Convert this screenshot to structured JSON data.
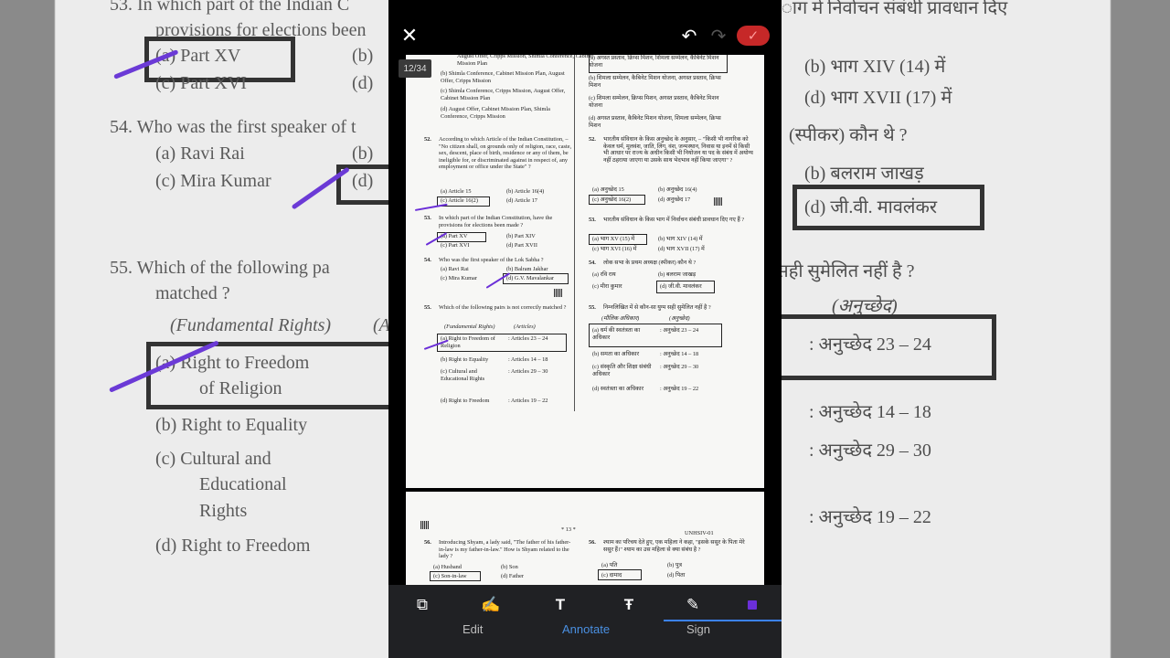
{
  "background": {
    "left": {
      "q53": "53.  In which part of the Indian C",
      "q53b": "provisions for elections been",
      "opt_a": "(a)  Part XV",
      "opt_b": "(b)",
      "opt_c": "(c)  Part XVI",
      "opt_d": "(d)",
      "q54": "54.  Who was the first speaker of t",
      "q54a": "(a)  Ravi Rai",
      "q54b": "(b)",
      "q54c": "(c)  Mira Kumar",
      "q54d": "(d)",
      "q55": "55.  Which of the following pa",
      "q55b": "matched ?",
      "fr": "(Fundamental Rights)",
      "fr2": "(A",
      "a1": "(a)  Right to Freedom",
      "a1b": "of Religion",
      "b1": "(b)  Right to Equality",
      "c1": "(c)  Cultural and",
      "c1b": "Educational",
      "c1c": "Rights",
      "d1": "(d)  Right to Freedom"
    },
    "right": {
      "top": "ाग में निर्वाचन संबंधी प्रावधान दिए",
      "b": "(b)  भाग XIV (14) में",
      "d": "(d)  भाग XVII (17) में",
      "spk": "(स्पीकर) कौन थे ?",
      "bb": "(b)  बलराम जाखड़",
      "dd": "(d)  जी.वी. मावलंकर",
      "q55": "युग्म सही सुमेलित नहीं है ?",
      "art": "(अनुच्छेद)",
      "r1": ":  अनुच्छेद 23 – 24",
      "r2": ":  अनुच्छेद 14 – 18",
      "r3": ":  अनुच्छेद 29 – 30",
      "r4": ":  अनुच्छेद 19 – 22"
    }
  },
  "viewer": {
    "page_indicator": "12/34",
    "close_icon": "✕",
    "undo_icon": "↶",
    "redo_icon": "↷",
    "confirm_icon": "✓"
  },
  "page1": {
    "left": {
      "q51_b": "(b)  Shimla Conference, Cabinet Mission Plan, August Offer, Cripps Mission",
      "q51_c": "(c)  Shimla Conference, Cripps Mission, August Offer, Cabinet Mission Plan",
      "q51_d": "(d)  August Offer, Cabinet Mission Plan, Shimla Conference, Cripps Mission",
      "q51_top": "August Offer, Cripps Mission, Shimla Conference, Cabinet Mission Plan",
      "q52_num": "52.",
      "q52_text": "According to which Article of the Indian Constitution, – \"No citizen shall, on grounds only of religion, race, caste, sex, descent, place of birth, residence or any of them, be ineligible for, or discriminated against in respect of, any employment or office under the State\" ?",
      "q52_a": "(a)  Article 15",
      "q52_b": "(b)  Article 16(4)",
      "q52_c": "(c)  Article 16(2)",
      "q52_d": "(d)  Article 17",
      "q53_num": "53.",
      "q53_text": "In which part of the Indian Constitution, have the provisions for elections been made ?",
      "q53_a": "(a)  Part XV",
      "q53_b": "(b)  Part XIV",
      "q53_c": "(c)  Part XVI",
      "q53_d": "(d)  Part XVII",
      "q54_num": "54.",
      "q54_text": "Who was the first speaker of the Lok Sabha ?",
      "q54_a": "(a)  Ravi Rai",
      "q54_b": "(b)  Balram Jakhar",
      "q54_c": "(c)  Mira Kumar",
      "q54_d": "(d)  G.V. Mavalankar",
      "q55_num": "55.",
      "q55_text": "Which of the following pairs is not correctly matched ?",
      "q55_h1": "(Fundamental Rights)",
      "q55_h2": "(Articles)",
      "q55_a": "(a)  Right to Freedom of Religion",
      "q55_a2": ":  Articles 23 – 24",
      "q55_b": "(b)  Right to Equality",
      "q55_b2": ":  Articles 14 – 18",
      "q55_c": "(c)  Cultural and Educational Rights",
      "q55_c2": ":  Articles 29 – 30",
      "q55_d": "(d)  Right to Freedom",
      "q55_d2": ":  Articles 19 – 22"
    },
    "right": {
      "q51_a": "(a)  अगस्त प्रस्ताव, क्रिप्स मिशन, शिमला सम्मेलन, कैबिनेट मिशन योजना",
      "q51_b": "(b)  शिमला सम्मेलन, कैबिनेट मिशन योजना, अगस्त प्रस्ताव, क्रिप्स मिशन",
      "q51_c": "(c)  शिमला सम्मेलन, क्रिप्स मिशन, अगस्त प्रस्ताव, कैबिनेट मिशन योजना",
      "q51_d": "(d)  अगस्त प्रस्ताव, कैबिनेट मिशन योजना, शिमला सम्मेलन, क्रिप्स मिशन",
      "q52_num": "52.",
      "q52_text": "भारतीय संविधान के किस अनुच्छेद के अनुसार, – \"किसी भी नागरिक को केवल धर्म, मूलवंश, जाति, लिंग, वंश, जन्मस्थान, निवास या इनमें से किसी भी आधार पर राज्य के अधीन किसी भी नियोजन या पद के संबंध में अयोग्य नहीं ठहराया जाएगा या उसके साथ भेदभाव नहीं किया जाएगा\" ?",
      "q52_a": "(a)  अनुच्छेद 15",
      "q52_b": "(b)  अनुच्छेद 16(4)",
      "q52_c": "(c)  अनुच्छेद 16(2)",
      "q52_d": "(d)  अनुच्छेद 17",
      "q53_num": "53.",
      "q53_text": "भारतीय संविधान के किस भाग में निर्वाचन संबंधी प्रावधान दिए गए हैं ?",
      "q53_a": "(a)  भाग XV (15) में",
      "q53_b": "(b)  भाग XIV (14) में",
      "q53_c": "(c)  भाग XVI (16) में",
      "q53_d": "(d)  भाग XVII (17) में",
      "q54_num": "54.",
      "q54_text": "लोक सभा के प्रथम अध्यक्ष (स्पीकर) कौन थे ?",
      "q54_a": "(a)  रवि राय",
      "q54_b": "(b)  बलराम जाखड़",
      "q54_c": "(c)  मीरा कुमार",
      "q54_d": "(d)  जी.वी. मावलंकर",
      "q55_num": "55.",
      "q55_text": "निम्नलिखित में से कौन-सा युग्म सही सुमेलित नहीं है ?",
      "q55_h1": "(मौलिक अधिकार)",
      "q55_h2": "(अनुच्छेद)",
      "q55_a": "(a)  धर्म की स्वतंत्रता का अधिकार",
      "q55_a2": ":  अनुच्छेद 23 – 24",
      "q55_b": "(b)  समता का अधिकार",
      "q55_b2": ":  अनुच्छेद 14 – 18",
      "q55_c": "(c)  संस्कृति और शिक्षा संबंधी अधिकार",
      "q55_c2": ":  अनुच्छेद 29 – 30",
      "q55_d": "(d)  स्वतंत्रता का अधिकार",
      "q55_d2": ":  अनुच्छेद 19 – 22"
    }
  },
  "page2": {
    "page_no": "* 13 *",
    "code": "UNHSIV-01",
    "q56_num": "56.",
    "q56_text": "Introducing Shyam, a lady said, \"The father of his father-in-law is my father-in-law.\" How is Shyam related to the lady ?",
    "q56_a": "(a)  Husband",
    "q56_b": "(b)  Son",
    "q56_c": "(c)  Son-in-law",
    "q56_d": "(d)  Father",
    "q56h_num": "56.",
    "q56h_text": "श्याम का परिचय देते हुए, एक महिला ने कहा, \"इसके ससुर के पिता मेरे ससुर हैं।\" श्याम का उस महिला से क्या संबंध है ?",
    "q56h_a": "(a)  पति",
    "q56h_b": "(b)  पुत्र",
    "q56h_c": "(c)  दामाद",
    "q56h_d": "(d)  पिता"
  },
  "toolbar": {
    "tools": [
      {
        "name": "pages-icon",
        "glyph": "⧉"
      },
      {
        "name": "highlighter-icon",
        "glyph": "✍"
      },
      {
        "name": "text-icon",
        "glyph": "T"
      },
      {
        "name": "strikethrough-icon",
        "glyph": "Ŧ"
      },
      {
        "name": "pen-icon",
        "glyph": "✎"
      }
    ],
    "tabs": {
      "edit": "Edit",
      "annotate": "Annotate",
      "sign": "Sign"
    },
    "active_tab": "annotate",
    "accent_color": "#3b82f6",
    "ink_color": "#6b2fd8"
  }
}
